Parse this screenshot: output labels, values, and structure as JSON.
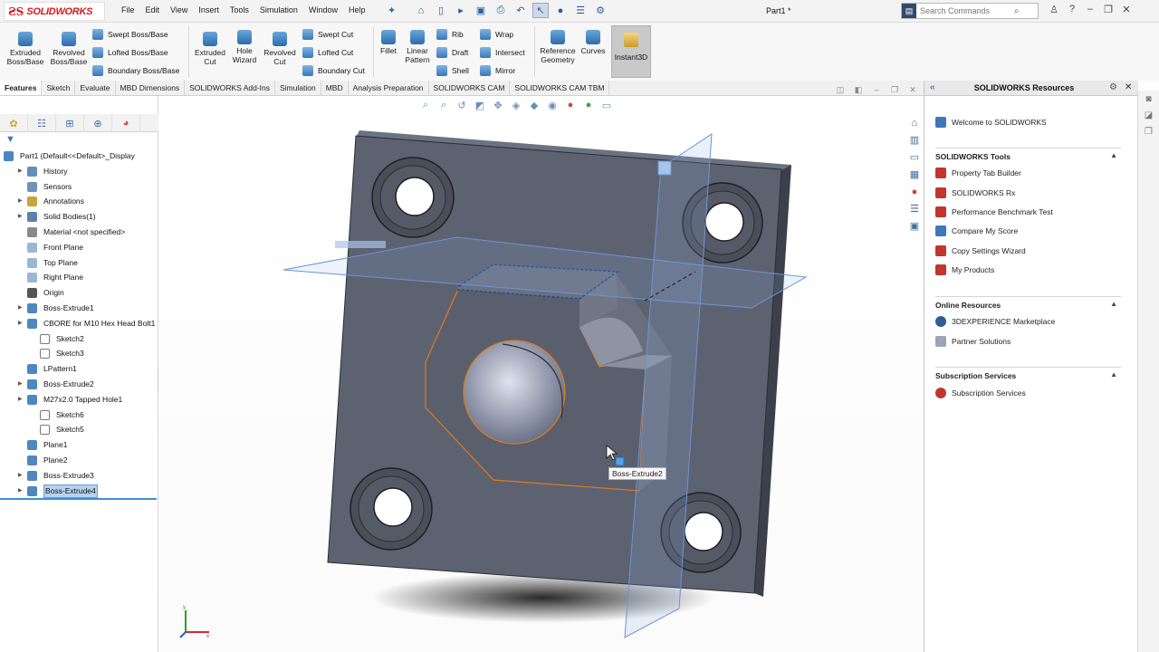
{
  "app": {
    "brand": "SOLIDWORKS",
    "doc_title": "Part1 *"
  },
  "menu": [
    "File",
    "Edit",
    "View",
    "Insert",
    "Tools",
    "Simulation",
    "Window",
    "Help"
  ],
  "search": {
    "placeholder": "Search Commands"
  },
  "features_toolbar": {
    "extruded_boss": "Extruded Boss/Base",
    "revolved_boss": "Revolved Boss/Base",
    "swept_boss": "Swept Boss/Base",
    "lofted_boss": "Lofted Boss/Base",
    "boundary_boss": "Boundary Boss/Base",
    "extruded_cut": "Extruded Cut",
    "hole_wizard": "Hole Wizard",
    "revolved_cut": "Revolved Cut",
    "swept_cut": "Swept Cut",
    "lofted_cut": "Lofted Cut",
    "boundary_cut": "Boundary Cut",
    "fillet": "Fillet",
    "linear_pattern": "Linear Pattern",
    "rib": "Rib",
    "draft": "Draft",
    "shell": "Shell",
    "wrap": "Wrap",
    "intersect": "Intersect",
    "mirror": "Mirror",
    "reference_geometry": "Reference Geometry",
    "curves": "Curves",
    "instant3d": "Instant3D"
  },
  "tabs": [
    "Features",
    "Sketch",
    "Evaluate",
    "MBD Dimensions",
    "SOLIDWORKS Add-Ins",
    "Simulation",
    "MBD",
    "Analysis Preparation",
    "SOLIDWORKS CAM",
    "SOLIDWORKS CAM TBM"
  ],
  "tree": [
    {
      "label": "Part1  (Default<<Default>_Display",
      "indent": 0,
      "expander": false,
      "icon": "part-icon",
      "color": "#4a86c5"
    },
    {
      "label": "History",
      "indent": 1,
      "expander": true,
      "icon": "history-icon",
      "color": "#5f8fbf"
    },
    {
      "label": "Sensors",
      "indent": 1,
      "expander": false,
      "icon": "sensor-icon",
      "color": "#6f93b8"
    },
    {
      "label": "Annotations",
      "indent": 1,
      "expander": true,
      "icon": "annotation-icon",
      "color": "#c9a43a"
    },
    {
      "label": "Solid Bodies(1)",
      "indent": 1,
      "expander": true,
      "icon": "solid-body-icon",
      "color": "#5b82a9"
    },
    {
      "label": "Material <not specified>",
      "indent": 1,
      "expander": false,
      "icon": "material-icon",
      "color": "#8a8a8a"
    },
    {
      "label": "Front Plane",
      "indent": 1,
      "expander": false,
      "icon": "plane-icon",
      "color": "#9bb7d6"
    },
    {
      "label": "Top Plane",
      "indent": 1,
      "expander": false,
      "icon": "plane-icon",
      "color": "#9bb7d6"
    },
    {
      "label": "Right Plane",
      "indent": 1,
      "expander": false,
      "icon": "plane-icon",
      "color": "#9bb7d6"
    },
    {
      "label": "Origin",
      "indent": 1,
      "expander": false,
      "icon": "origin-icon",
      "color": "#555555"
    },
    {
      "label": "Boss-Extrude1",
      "indent": 1,
      "expander": true,
      "icon": "extrude-icon",
      "color": "#4f87c0"
    },
    {
      "label": "CBORE for M10 Hex Head Bolt1",
      "indent": 1,
      "expander": true,
      "icon": "hole-icon",
      "color": "#4f87c0"
    },
    {
      "label": "Sketch2",
      "indent": 2,
      "expander": false,
      "icon": "sketch-icon",
      "color": "#ffffff"
    },
    {
      "label": "Sketch3",
      "indent": 2,
      "expander": false,
      "icon": "sketch-icon",
      "color": "#ffffff"
    },
    {
      "label": "LPattern1",
      "indent": 1,
      "expander": false,
      "icon": "pattern-icon",
      "color": "#4f87c0"
    },
    {
      "label": "Boss-Extrude2",
      "indent": 1,
      "expander": true,
      "icon": "extrude-icon",
      "color": "#4f87c0"
    },
    {
      "label": "M27x2.0 Tapped Hole1",
      "indent": 1,
      "expander": true,
      "icon": "hole-icon",
      "color": "#4f87c0"
    },
    {
      "label": "Sketch6",
      "indent": 2,
      "expander": false,
      "icon": "sketch-icon",
      "color": "#ffffff"
    },
    {
      "label": "Sketch5",
      "indent": 2,
      "expander": false,
      "icon": "sketch-icon",
      "color": "#ffffff"
    },
    {
      "label": "Plane1",
      "indent": 1,
      "expander": false,
      "icon": "plane-icon",
      "color": "#4f87c0"
    },
    {
      "label": "Plane2",
      "indent": 1,
      "expander": false,
      "icon": "plane-icon",
      "color": "#4f87c0"
    },
    {
      "label": "Boss-Extrude3",
      "indent": 1,
      "expander": true,
      "icon": "extrude-icon",
      "color": "#4f87c0"
    },
    {
      "label": "Boss-Extrude4",
      "indent": 1,
      "expander": true,
      "icon": "extrude-icon",
      "color": "#4f87c0",
      "selected": true
    }
  ],
  "viewport": {
    "tooltip": "Boss-Extrude2"
  },
  "resources": {
    "title": "SOLIDWORKS Resources",
    "welcome": "Welcome to SOLIDWORKS",
    "tools_header": "SOLIDWORKS Tools",
    "tools": [
      "Property Tab Builder",
      "SOLIDWORKS Rx",
      "Performance Benchmark Test",
      "Compare My Score",
      "Copy Settings Wizard",
      "My Products"
    ],
    "online_header": "Online Resources",
    "online": [
      "3DEXPERIENCE Marketplace",
      "Partner Solutions"
    ],
    "subscription_header": "Subscription Services",
    "subscription": [
      "Subscription Services"
    ]
  },
  "colors": {
    "accent": "#3c8fd6",
    "model": "#5d6270",
    "edge_highlight": "#e07b1c",
    "plane": "#8fb3e8"
  }
}
